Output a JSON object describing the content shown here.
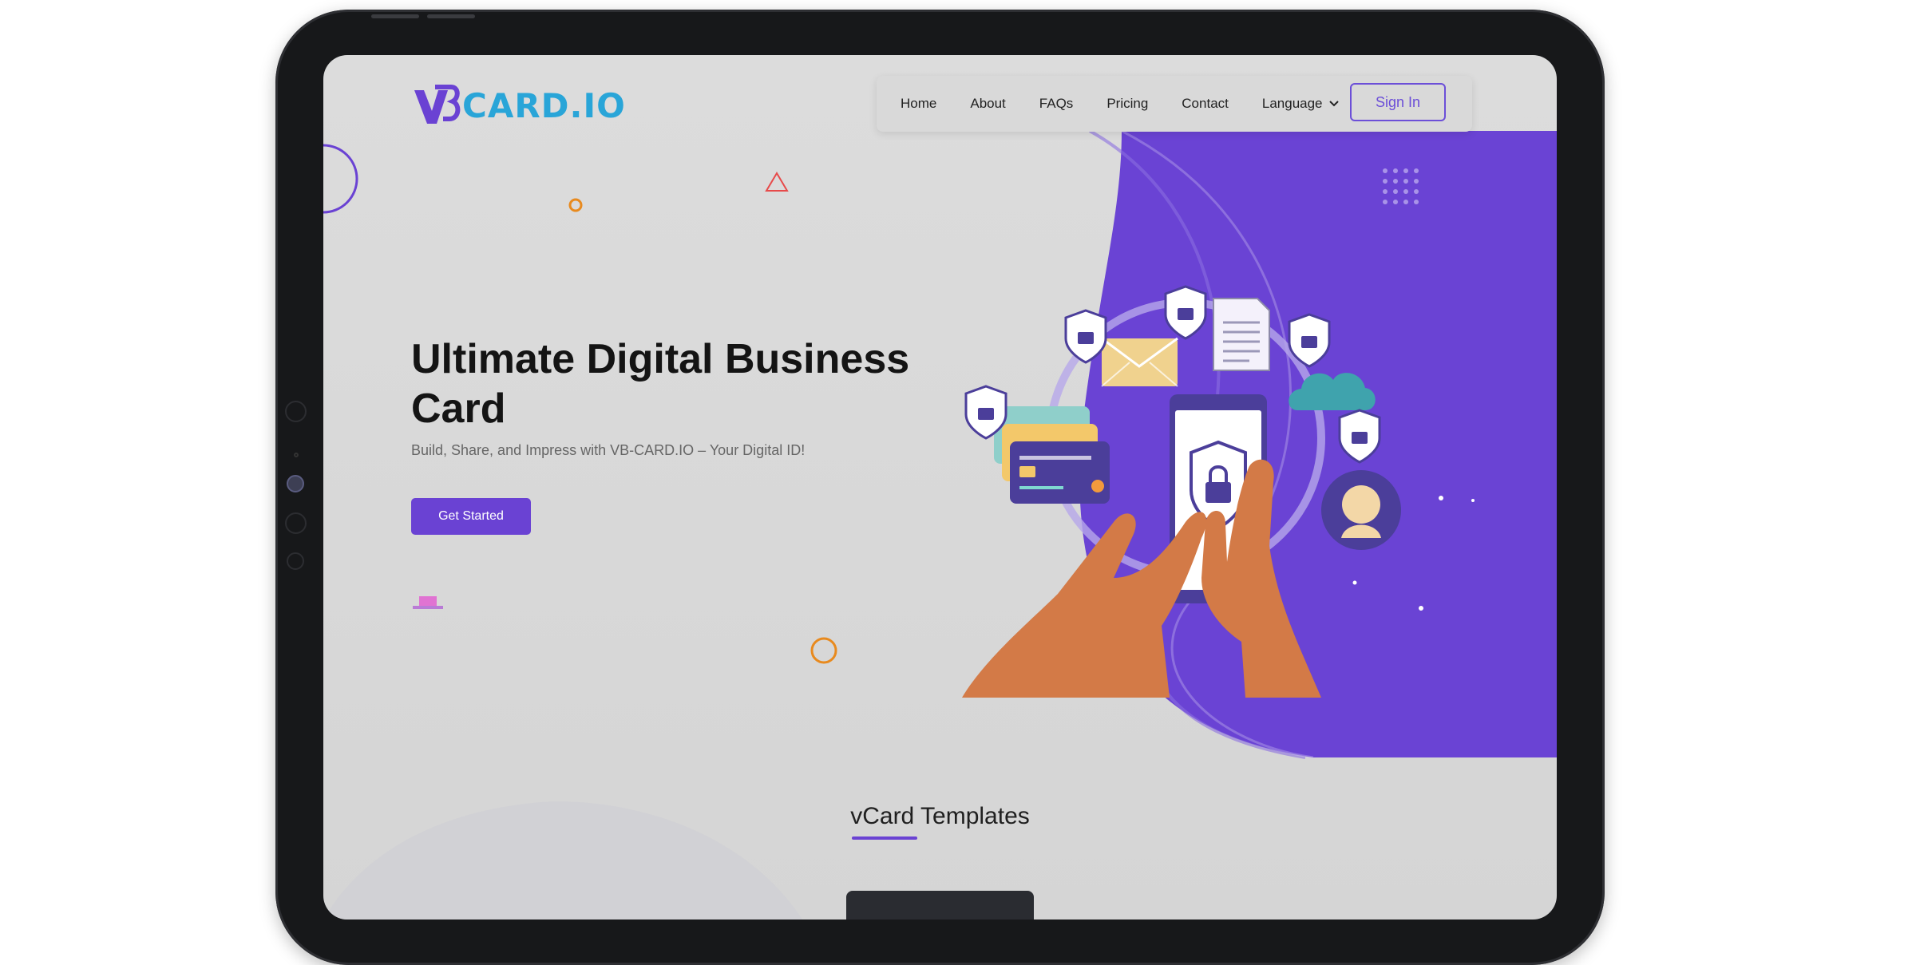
{
  "nav": {
    "logo_text": "CARD.IO",
    "links": [
      "Home",
      "About",
      "FAQs",
      "Pricing",
      "Contact"
    ],
    "language_label": "Language",
    "signin_label": "Sign In"
  },
  "hero": {
    "title": "Ultimate Digital Business Card",
    "subtitle": "Build, Share, and Impress with VB-CARD.IO – Your Digital ID!",
    "cta_label": "Get Started"
  },
  "section": {
    "title": "vCard Templates"
  },
  "colors": {
    "brand_purple": "#6a42d3",
    "brand_blue": "#29a5d8",
    "signin_outline": "#6c4fd8"
  },
  "icons": [
    "logo-mark-icon",
    "chevron-down-icon",
    "padlock-shield-icon",
    "envelope-icon",
    "document-icon",
    "cloud-icon",
    "credit-card-icon",
    "smartphone-icon",
    "user-avatar-icon"
  ]
}
